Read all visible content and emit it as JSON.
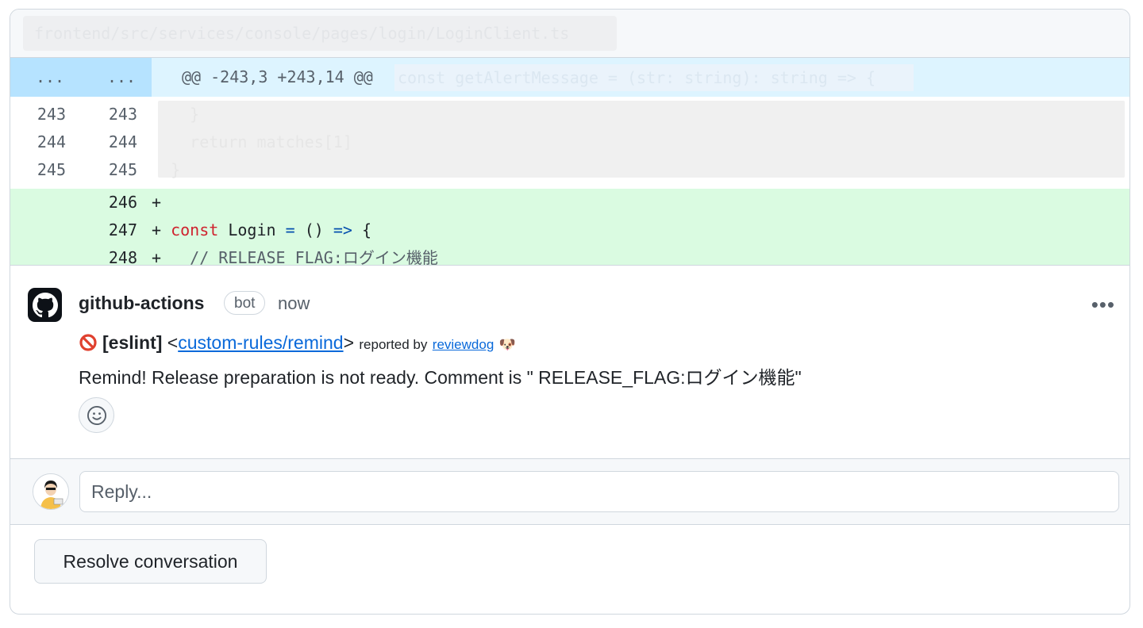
{
  "file": {
    "path": "frontend/src/services/console/pages/login/LoginClient.ts"
  },
  "diff": {
    "hunk": {
      "old_marker": "...",
      "new_marker": "...",
      "header": "@@ -243,3 +243,14 @@",
      "context": "const getAlertMessage = (str: string): string => {"
    },
    "context_lines": [
      {
        "old": "243",
        "new": "243",
        "code": "    }"
      },
      {
        "old": "244",
        "new": "244",
        "code": "    return matches[1]"
      },
      {
        "old": "245",
        "new": "245",
        "code": "  }"
      }
    ],
    "added_lines": [
      {
        "new": "246",
        "prefix": "+",
        "code": ""
      },
      {
        "new": "247",
        "prefix": "+",
        "kw": "const",
        "name": " Login ",
        "op1": "=",
        "mid": " () ",
        "op2": "=>",
        "rest": " {"
      },
      {
        "new": "248",
        "prefix": "+",
        "comment": "  // RELEASE_FLAG:ログイン機能"
      }
    ]
  },
  "comment": {
    "author": "github-actions",
    "badge": "bot",
    "time": "now",
    "more": "•••",
    "tag": "[eslint]",
    "rule_open": "<",
    "rule": "custom-rules/remind",
    "rule_close": ">",
    "reported_by": "reported by",
    "reporter": "reviewdog",
    "reporter_emoji": "🐶",
    "message": "Remind! Release preparation is not ready. Comment is \" RELEASE_FLAG:ログイン機能\""
  },
  "reply": {
    "placeholder": "Reply..."
  },
  "resolve": {
    "label": "Resolve conversation"
  },
  "colors": {
    "added_bg": "#dafbe1",
    "hunk_bg": "#ddf4ff",
    "link": "#0969da",
    "keyword": "#cf222e"
  }
}
